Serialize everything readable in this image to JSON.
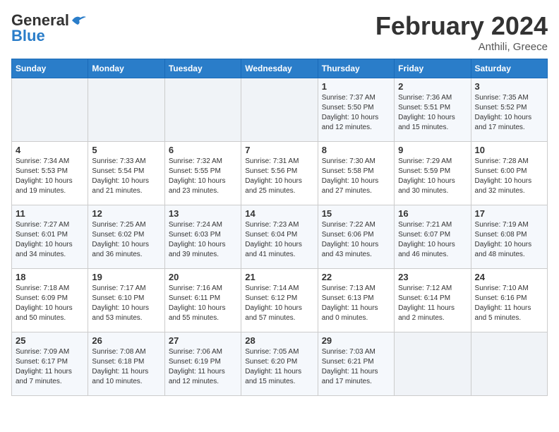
{
  "logo": {
    "line1": "General",
    "line2": "Blue"
  },
  "title": "February 2024",
  "location": "Anthili, Greece",
  "days_of_week": [
    "Sunday",
    "Monday",
    "Tuesday",
    "Wednesday",
    "Thursday",
    "Friday",
    "Saturday"
  ],
  "weeks": [
    [
      {
        "day": "",
        "info": ""
      },
      {
        "day": "",
        "info": ""
      },
      {
        "day": "",
        "info": ""
      },
      {
        "day": "",
        "info": ""
      },
      {
        "day": "1",
        "info": "Sunrise: 7:37 AM\nSunset: 5:50 PM\nDaylight: 10 hours\nand 12 minutes."
      },
      {
        "day": "2",
        "info": "Sunrise: 7:36 AM\nSunset: 5:51 PM\nDaylight: 10 hours\nand 15 minutes."
      },
      {
        "day": "3",
        "info": "Sunrise: 7:35 AM\nSunset: 5:52 PM\nDaylight: 10 hours\nand 17 minutes."
      }
    ],
    [
      {
        "day": "4",
        "info": "Sunrise: 7:34 AM\nSunset: 5:53 PM\nDaylight: 10 hours\nand 19 minutes."
      },
      {
        "day": "5",
        "info": "Sunrise: 7:33 AM\nSunset: 5:54 PM\nDaylight: 10 hours\nand 21 minutes."
      },
      {
        "day": "6",
        "info": "Sunrise: 7:32 AM\nSunset: 5:55 PM\nDaylight: 10 hours\nand 23 minutes."
      },
      {
        "day": "7",
        "info": "Sunrise: 7:31 AM\nSunset: 5:56 PM\nDaylight: 10 hours\nand 25 minutes."
      },
      {
        "day": "8",
        "info": "Sunrise: 7:30 AM\nSunset: 5:58 PM\nDaylight: 10 hours\nand 27 minutes."
      },
      {
        "day": "9",
        "info": "Sunrise: 7:29 AM\nSunset: 5:59 PM\nDaylight: 10 hours\nand 30 minutes."
      },
      {
        "day": "10",
        "info": "Sunrise: 7:28 AM\nSunset: 6:00 PM\nDaylight: 10 hours\nand 32 minutes."
      }
    ],
    [
      {
        "day": "11",
        "info": "Sunrise: 7:27 AM\nSunset: 6:01 PM\nDaylight: 10 hours\nand 34 minutes."
      },
      {
        "day": "12",
        "info": "Sunrise: 7:25 AM\nSunset: 6:02 PM\nDaylight: 10 hours\nand 36 minutes."
      },
      {
        "day": "13",
        "info": "Sunrise: 7:24 AM\nSunset: 6:03 PM\nDaylight: 10 hours\nand 39 minutes."
      },
      {
        "day": "14",
        "info": "Sunrise: 7:23 AM\nSunset: 6:04 PM\nDaylight: 10 hours\nand 41 minutes."
      },
      {
        "day": "15",
        "info": "Sunrise: 7:22 AM\nSunset: 6:06 PM\nDaylight: 10 hours\nand 43 minutes."
      },
      {
        "day": "16",
        "info": "Sunrise: 7:21 AM\nSunset: 6:07 PM\nDaylight: 10 hours\nand 46 minutes."
      },
      {
        "day": "17",
        "info": "Sunrise: 7:19 AM\nSunset: 6:08 PM\nDaylight: 10 hours\nand 48 minutes."
      }
    ],
    [
      {
        "day": "18",
        "info": "Sunrise: 7:18 AM\nSunset: 6:09 PM\nDaylight: 10 hours\nand 50 minutes."
      },
      {
        "day": "19",
        "info": "Sunrise: 7:17 AM\nSunset: 6:10 PM\nDaylight: 10 hours\nand 53 minutes."
      },
      {
        "day": "20",
        "info": "Sunrise: 7:16 AM\nSunset: 6:11 PM\nDaylight: 10 hours\nand 55 minutes."
      },
      {
        "day": "21",
        "info": "Sunrise: 7:14 AM\nSunset: 6:12 PM\nDaylight: 10 hours\nand 57 minutes."
      },
      {
        "day": "22",
        "info": "Sunrise: 7:13 AM\nSunset: 6:13 PM\nDaylight: 11 hours\nand 0 minutes."
      },
      {
        "day": "23",
        "info": "Sunrise: 7:12 AM\nSunset: 6:14 PM\nDaylight: 11 hours\nand 2 minutes."
      },
      {
        "day": "24",
        "info": "Sunrise: 7:10 AM\nSunset: 6:16 PM\nDaylight: 11 hours\nand 5 minutes."
      }
    ],
    [
      {
        "day": "25",
        "info": "Sunrise: 7:09 AM\nSunset: 6:17 PM\nDaylight: 11 hours\nand 7 minutes."
      },
      {
        "day": "26",
        "info": "Sunrise: 7:08 AM\nSunset: 6:18 PM\nDaylight: 11 hours\nand 10 minutes."
      },
      {
        "day": "27",
        "info": "Sunrise: 7:06 AM\nSunset: 6:19 PM\nDaylight: 11 hours\nand 12 minutes."
      },
      {
        "day": "28",
        "info": "Sunrise: 7:05 AM\nSunset: 6:20 PM\nDaylight: 11 hours\nand 15 minutes."
      },
      {
        "day": "29",
        "info": "Sunrise: 7:03 AM\nSunset: 6:21 PM\nDaylight: 11 hours\nand 17 minutes."
      },
      {
        "day": "",
        "info": ""
      },
      {
        "day": "",
        "info": ""
      }
    ]
  ]
}
